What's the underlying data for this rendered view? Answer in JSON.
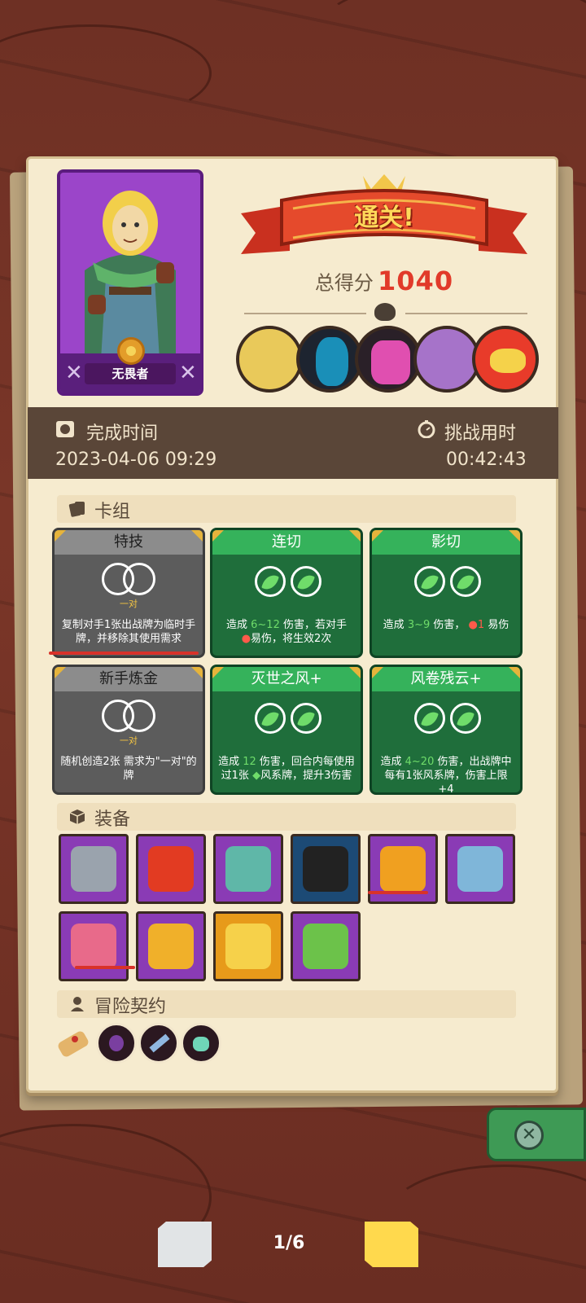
{
  "hero": {
    "name": "无畏者"
  },
  "banner": {
    "label": "通关!"
  },
  "score": {
    "label": "总得分",
    "value": "1040"
  },
  "bosses": [
    {
      "name": "scarecrow-witch-boss",
      "color": "#e9c95a"
    },
    {
      "name": "shadow-beast-boss",
      "color": "#1a8fb8"
    },
    {
      "name": "dark-knight-boss",
      "color": "#e04fb0"
    },
    {
      "name": "purple-dragon-boss",
      "color": "#a673c9"
    },
    {
      "name": "fire-demon-boss",
      "color": "#e83b2a"
    }
  ],
  "stats": {
    "completion_label": "完成时间",
    "completion_value": "2023-04-06 09:29",
    "duration_label": "挑战用时",
    "duration_value": "00:42:43"
  },
  "deck": {
    "label": "卡组",
    "cards": [
      {
        "title": "特技",
        "tag": "一对",
        "desc_a": "复制对手1张出战牌为临时手牌，并移除其使用需求",
        "type": "gray"
      },
      {
        "title": "连切",
        "desc_a": "造成",
        "dmg": "6~12",
        "desc_b": "伤害，若对手",
        "desc_c": "易伤，将生效2次",
        "type": "green"
      },
      {
        "title": "影切",
        "desc_a": "造成",
        "dmg": "3~9",
        "desc_b": "伤害，",
        "vuln": "1",
        "desc_c": "易伤",
        "type": "green"
      },
      {
        "title": "新手炼金",
        "tag": "一对",
        "desc_a": "随机创造2张 需求为\"一对\"的牌",
        "type": "gray"
      },
      {
        "title": "灭世之风+",
        "desc_a": "造成",
        "dmg": "12",
        "desc_b": "伤害，回合内每使用过1张",
        "desc_c": "风系牌，提升3伤害",
        "type": "green"
      },
      {
        "title": "风卷残云+",
        "desc_a": "造成",
        "dmg": "4~20",
        "desc_b": "伤害，出战牌中每有1张风系牌，伤害上限+4",
        "type": "green"
      }
    ]
  },
  "equipment": {
    "label": "装备",
    "items": [
      {
        "name": "cube-maze-icon",
        "bg": "purple"
      },
      {
        "name": "fire-potion-icon",
        "bg": "purple"
      },
      {
        "name": "leaf-ring-icon",
        "bg": "purple"
      },
      {
        "name": "magic-hat-dice-icon",
        "bg": "blue"
      },
      {
        "name": "flame-gem-icon",
        "bg": "purple"
      },
      {
        "name": "silver-horn-icon",
        "bg": "purple"
      },
      {
        "name": "spotted-egg-icon",
        "bg": "purple"
      },
      {
        "name": "golden-glove-icon",
        "bg": "purple"
      },
      {
        "name": "golden-crown-icon",
        "bg": "orange"
      },
      {
        "name": "green-leaves-icon",
        "bg": "purple"
      }
    ]
  },
  "contract": {
    "label": "冒险契约",
    "items": [
      {
        "name": "scroll-icon"
      },
      {
        "name": "dark-flask-icon"
      },
      {
        "name": "crystal-bar-icon"
      },
      {
        "name": "green-potion-icon"
      }
    ]
  },
  "pagination": {
    "current": "1/6"
  },
  "colors": {
    "score": "#e13a2a",
    "panel": "#f6ebcf",
    "stats_bar": "#5a4638"
  }
}
